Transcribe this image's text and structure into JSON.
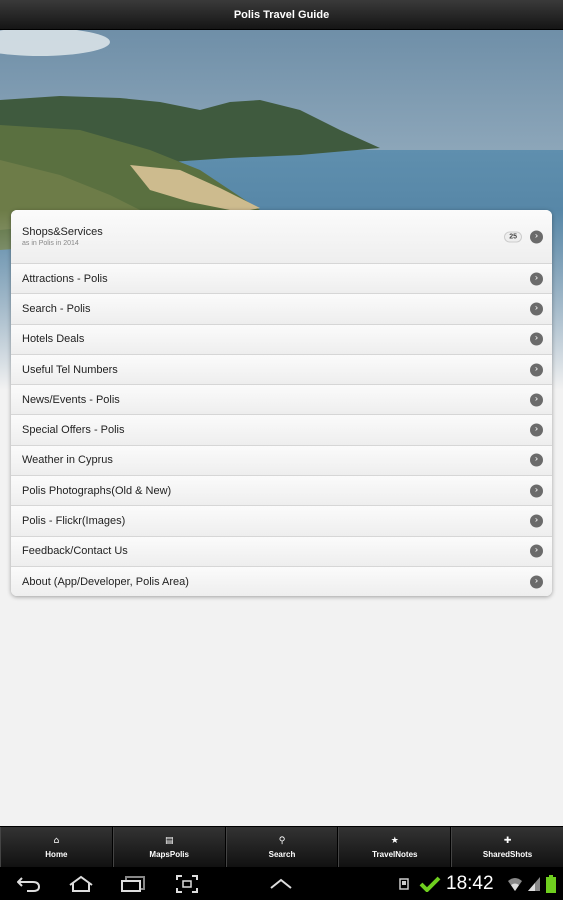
{
  "app": {
    "title": "Polis Travel Guide"
  },
  "menu": {
    "header": {
      "label": "Shops&Services",
      "subtitle": "as in Polis in 2014",
      "count": "25"
    },
    "items": [
      {
        "label": "Attractions - Polis"
      },
      {
        "label": "Search - Polis"
      },
      {
        "label": "Hotels Deals"
      },
      {
        "label": "Useful Tel Numbers"
      },
      {
        "label": "News/Events - Polis"
      },
      {
        "label": "Special Offers - Polis"
      },
      {
        "label": "Weather in Cyprus"
      },
      {
        "label": "Polis Photographs(Old & New)"
      },
      {
        "label": "Polis - Flickr(Images)"
      },
      {
        "label": "Feedback/Contact Us"
      },
      {
        "label": "About (App/Developer, Polis Area)"
      }
    ]
  },
  "tabs": [
    {
      "label": "Home",
      "icon": "home-icon"
    },
    {
      "label": "MapsPolis",
      "icon": "map-icon"
    },
    {
      "label": "Search",
      "icon": "search-icon"
    },
    {
      "label": "TravelNotes",
      "icon": "star-icon"
    },
    {
      "label": "SharedShots",
      "icon": "plus-icon"
    }
  ],
  "status": {
    "time": "18:42"
  },
  "colors": {
    "bar_dark": "#151515",
    "accent_green": "#6fcf1f",
    "arrow_gray": "#6b6b6b"
  }
}
